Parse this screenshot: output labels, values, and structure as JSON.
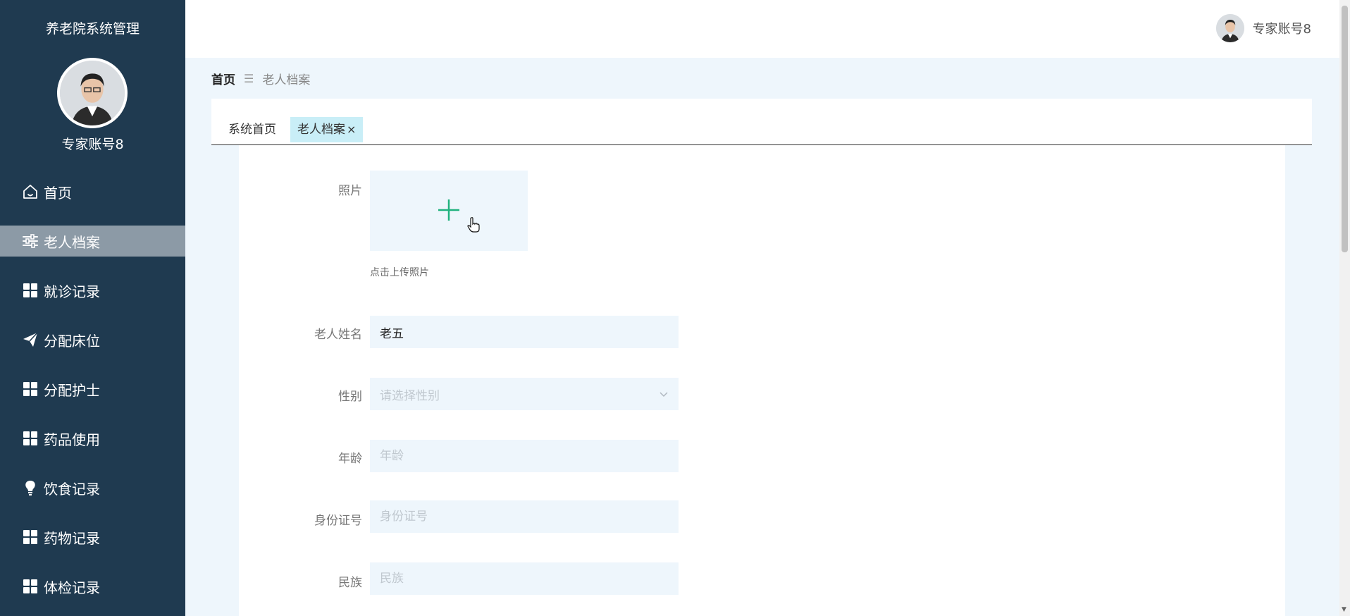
{
  "sidebar": {
    "title": "养老院系统管理",
    "user_name": "专家账号8",
    "items": [
      {
        "label": "首页",
        "icon": "home-icon",
        "active": false
      },
      {
        "label": "老人档案",
        "icon": "sliders-icon",
        "active": true
      },
      {
        "label": "就诊记录",
        "icon": "grid-icon",
        "active": false
      },
      {
        "label": "分配床位",
        "icon": "paper-plane-icon",
        "active": false
      },
      {
        "label": "分配护士",
        "icon": "grid-icon",
        "active": false
      },
      {
        "label": "药品使用",
        "icon": "grid-icon",
        "active": false
      },
      {
        "label": "饮食记录",
        "icon": "bulb-icon",
        "active": false
      },
      {
        "label": "药物记录",
        "icon": "grid-icon",
        "active": false
      },
      {
        "label": "体检记录",
        "icon": "grid-icon",
        "active": false
      }
    ]
  },
  "header": {
    "user_name": "专家账号8"
  },
  "breadcrumb": {
    "home": "首页",
    "separator": "☰",
    "current": "老人档案"
  },
  "tabs": [
    {
      "label": "系统首页",
      "active": false
    },
    {
      "label": "老人档案",
      "active": true,
      "close": "×"
    }
  ],
  "form": {
    "photo": {
      "label": "照片",
      "hint": "点击上传照片"
    },
    "name": {
      "label": "老人姓名",
      "value": "老五"
    },
    "gender": {
      "label": "性别",
      "placeholder": "请选择性别"
    },
    "age": {
      "label": "年龄",
      "placeholder": "年龄"
    },
    "id_number": {
      "label": "身份证号",
      "placeholder": "身份证号"
    },
    "ethnicity": {
      "label": "民族",
      "placeholder": "民族"
    }
  },
  "colors": {
    "sidebar_bg": "#1f3a50",
    "active_menu_bg": "#8c9aa6",
    "accent_plus": "#20b27e",
    "field_bg": "#eef6fc",
    "active_tab_bg": "#c9eef7"
  }
}
